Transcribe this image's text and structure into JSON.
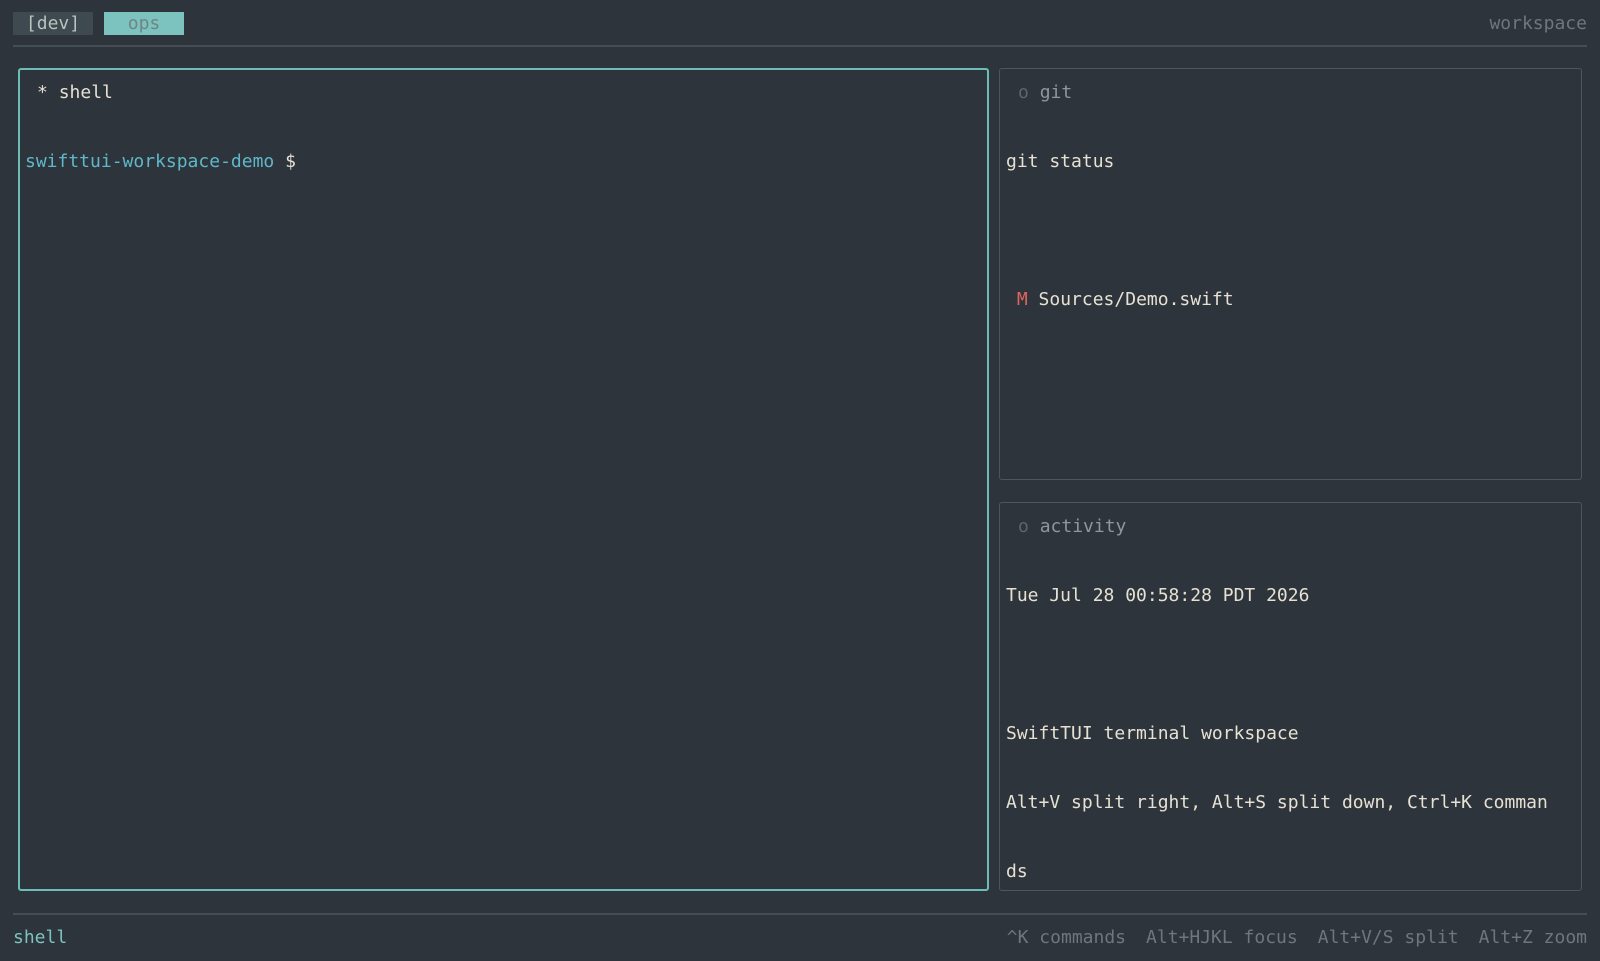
{
  "tabbar": {
    "tabs": [
      {
        "label": "[dev]",
        "active": false
      },
      {
        "label": " ops ",
        "active": true
      }
    ],
    "workspace_label": "workspace"
  },
  "panes": {
    "shell": {
      "marker": "*",
      "title": "shell",
      "prompt_path": "swifttui-workspace-demo",
      "prompt_sign": "$"
    },
    "git": {
      "marker": "o",
      "title": "git",
      "command": "git status",
      "file_status": "M",
      "file_path": "Sources/Demo.swift"
    },
    "activity": {
      "marker": "o",
      "title": "activity",
      "timestamp": "Tue Jul 28 00:58:28 PDT 2026",
      "heading": "SwiftTUI terminal workspace",
      "help_line_1": "Alt+V split right, Alt+S split down, Ctrl+K comman",
      "help_line_2": "ds"
    }
  },
  "statusbar": {
    "focused_pane": "shell",
    "hints": [
      "^K commands",
      "Alt+HJKL focus",
      "Alt+V/S split",
      "Alt+Z zoom"
    ]
  },
  "colors": {
    "background": "#2d343b",
    "accent": "#6cbcb8",
    "prompt": "#5fb8c9",
    "modified": "#e0655e"
  }
}
